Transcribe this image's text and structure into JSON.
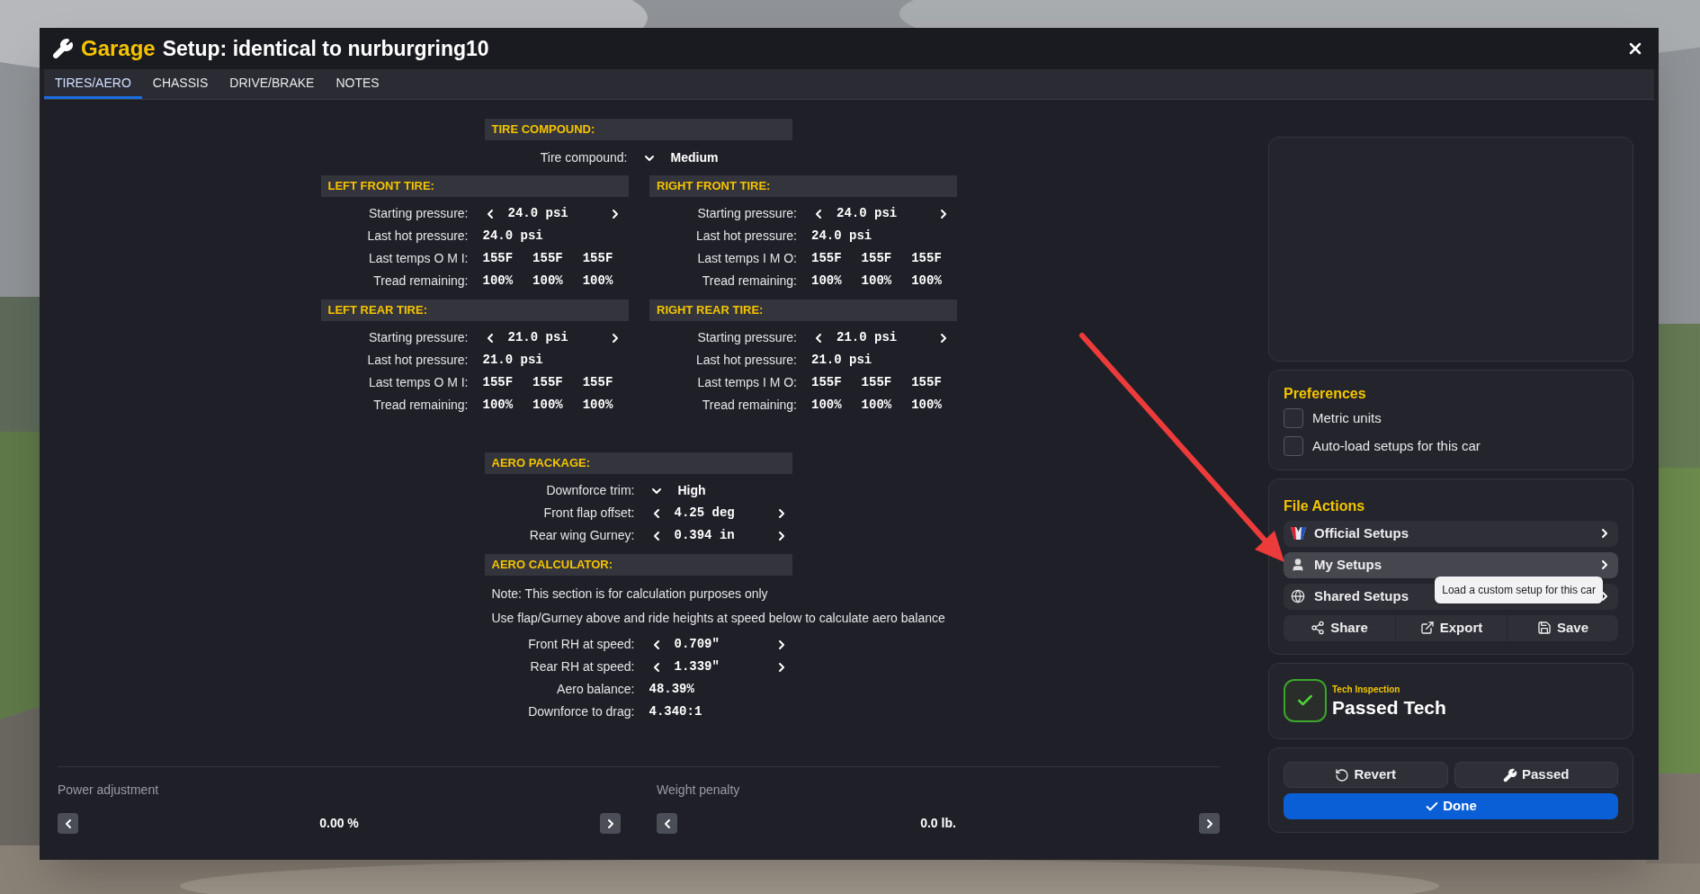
{
  "window": {
    "app": "Garage",
    "title": "Setup: identical to nurburgring10"
  },
  "tabs": [
    {
      "label": "TIRES/AERO",
      "selected": true
    },
    {
      "label": "CHASSIS",
      "selected": false
    },
    {
      "label": "DRIVE/BRAKE",
      "selected": false
    },
    {
      "label": "NOTES",
      "selected": false
    }
  ],
  "tire_compound": {
    "header": "TIRE COMPOUND:",
    "rows": [
      {
        "kind": "select",
        "label": "Tire compound:",
        "value": "Medium"
      }
    ]
  },
  "tires": [
    {
      "header": "LEFT FRONT TIRE:",
      "rows": [
        {
          "kind": "stepper",
          "label": "Starting pressure:",
          "value": "24.0 psi"
        },
        {
          "kind": "text",
          "label": "Last hot pressure:",
          "values": [
            "24.0 psi"
          ]
        },
        {
          "kind": "text",
          "label": "Last temps O M I:",
          "values": [
            "155F",
            "155F",
            "155F"
          ]
        },
        {
          "kind": "text",
          "label": "Tread remaining:",
          "values": [
            "100%",
            "100%",
            "100%"
          ]
        }
      ]
    },
    {
      "header": "RIGHT FRONT TIRE:",
      "rows": [
        {
          "kind": "stepper",
          "label": "Starting pressure:",
          "value": "24.0 psi"
        },
        {
          "kind": "text",
          "label": "Last hot pressure:",
          "values": [
            "24.0 psi"
          ]
        },
        {
          "kind": "text",
          "label": "Last temps I M O:",
          "values": [
            "155F",
            "155F",
            "155F"
          ]
        },
        {
          "kind": "text",
          "label": "Tread remaining:",
          "values": [
            "100%",
            "100%",
            "100%"
          ]
        }
      ]
    },
    {
      "header": "LEFT REAR TIRE:",
      "rows": [
        {
          "kind": "stepper",
          "label": "Starting pressure:",
          "value": "21.0 psi"
        },
        {
          "kind": "text",
          "label": "Last hot pressure:",
          "values": [
            "21.0 psi"
          ]
        },
        {
          "kind": "text",
          "label": "Last temps O M I:",
          "values": [
            "155F",
            "155F",
            "155F"
          ]
        },
        {
          "kind": "text",
          "label": "Tread remaining:",
          "values": [
            "100%",
            "100%",
            "100%"
          ]
        }
      ]
    },
    {
      "header": "RIGHT REAR TIRE:",
      "rows": [
        {
          "kind": "stepper",
          "label": "Starting pressure:",
          "value": "21.0 psi"
        },
        {
          "kind": "text",
          "label": "Last hot pressure:",
          "values": [
            "21.0 psi"
          ]
        },
        {
          "kind": "text",
          "label": "Last temps I M O:",
          "values": [
            "155F",
            "155F",
            "155F"
          ]
        },
        {
          "kind": "text",
          "label": "Tread remaining:",
          "values": [
            "100%",
            "100%",
            "100%"
          ]
        }
      ]
    }
  ],
  "aero_package": {
    "header": "AERO PACKAGE:",
    "rows": [
      {
        "kind": "select",
        "label": "Downforce trim:",
        "value": "High"
      },
      {
        "kind": "stepper",
        "label": "Front flap offset:",
        "value": "4.25 deg"
      },
      {
        "kind": "stepper",
        "label": "Rear wing Gurney:",
        "value": "0.394 in"
      }
    ]
  },
  "aero_calculator": {
    "header": "AERO CALCULATOR:",
    "notes": [
      "Note: This section is for calculation purposes only",
      "Use flap/Gurney above and ride heights at speed below to calculate aero balance"
    ],
    "rows": [
      {
        "kind": "stepper",
        "label": "Front RH at speed:",
        "value": "0.709\""
      },
      {
        "kind": "stepper",
        "label": "Rear RH at speed:",
        "value": "1.339\""
      },
      {
        "kind": "text",
        "label": "Aero balance:",
        "values": [
          "48.39%"
        ]
      },
      {
        "kind": "text",
        "label": "Downforce to drag:",
        "values": [
          "4.340:1"
        ]
      }
    ]
  },
  "adjustments": [
    {
      "label": "Power adjustment",
      "value": "0.00 %"
    },
    {
      "label": "Weight penalty",
      "value": "0.0 lb."
    }
  ],
  "preferences": {
    "title": "Preferences",
    "options": [
      {
        "label": "Metric units",
        "checked": false
      },
      {
        "label": "Auto-load setups for this car",
        "checked": false
      }
    ]
  },
  "file_actions": {
    "title": "File Actions",
    "items": [
      {
        "kind": "official",
        "label": "Official Setups",
        "hovered": false
      },
      {
        "kind": "mine",
        "label": "My Setups",
        "hovered": true
      },
      {
        "kind": "shared",
        "label": "Shared Setups",
        "hovered": false
      }
    ],
    "buttons": [
      {
        "kind": "share",
        "label": "Share"
      },
      {
        "kind": "export",
        "label": "Export"
      },
      {
        "kind": "save",
        "label": "Save"
      }
    ],
    "tooltip": "Load a custom setup for this car"
  },
  "tech": {
    "caption": "Tech Inspection",
    "status": "Passed Tech",
    "passed": true
  },
  "actions": [
    {
      "kind": "revert",
      "label": "Revert"
    },
    {
      "kind": "passed",
      "label": "Passed"
    }
  ],
  "done": "Done"
}
